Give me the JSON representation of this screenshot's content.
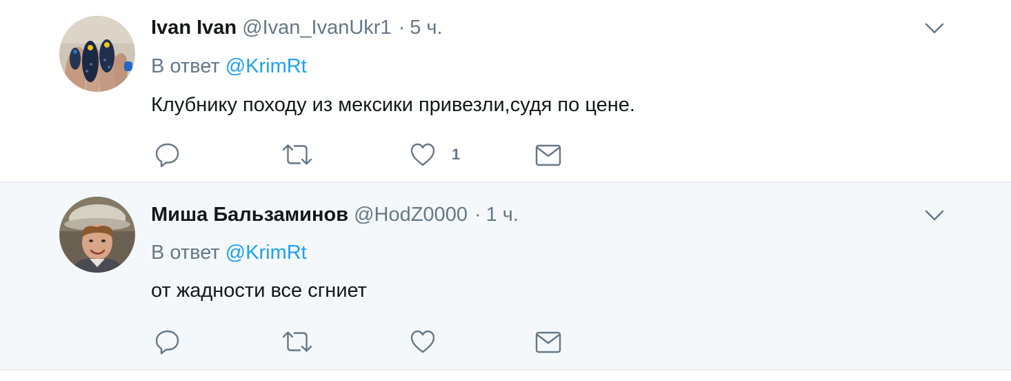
{
  "tweets": [
    {
      "fullname": "Ivan Ivan",
      "handle": "@Ivan_IvanUkr1",
      "separator": "·",
      "time": "5 ч.",
      "reply_prefix": "В ответ",
      "reply_handle": "@KrimRt",
      "text": "Клубнику походу из мексики привезли,судя по цене.",
      "like_count": "1"
    },
    {
      "fullname": "Миша Бальзаминов",
      "handle": "@HodZ0000",
      "separator": "·",
      "time": "1 ч.",
      "reply_prefix": "В ответ",
      "reply_handle": "@KrimRt",
      "text": "от жадности все сгниет",
      "like_count": ""
    }
  ],
  "colors": {
    "link_blue": "#1da1f2",
    "secondary_gray": "#657786",
    "text_dark": "#14171a",
    "highlight_bg": "#f5f8fa",
    "divider": "#e6ecf0"
  },
  "icons": [
    "reply-icon",
    "retweet-icon",
    "like-icon",
    "direct-message-icon",
    "chevron-down-icon"
  ]
}
